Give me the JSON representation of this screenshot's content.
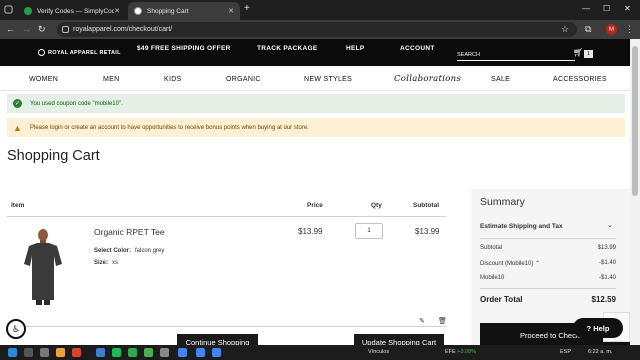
{
  "browser": {
    "tabs": [
      {
        "title": "Verify Codes — SimplyCodes",
        "favicon_color": "#21a04a"
      },
      {
        "title": "Shopping Cart",
        "favicon_color": "#ffffff"
      }
    ],
    "url": "royalapparel.com/checkout/cart/",
    "profile_initial": "M"
  },
  "site": {
    "logo": "ROYAL APPAREL RETAIL",
    "top_nav": [
      "$49 FREE SHIPPING OFFER",
      "TRACK PACKAGE",
      "HELP",
      "ACCOUNT"
    ],
    "search_placeholder": "SEARCH",
    "cart_count": "1",
    "categories": [
      "WOMEN",
      "MEN",
      "KIDS",
      "ORGANIC",
      "NEW STYLES",
      "Collaborations",
      "SALE",
      "ACCESSORIES"
    ]
  },
  "messages": {
    "success": "You used coupon code \"mobile10\".",
    "notice": "Please login or create an account to have opportunities to receive bonus points when buying at our store."
  },
  "page_title": "Shopping Cart",
  "cart": {
    "headers": {
      "item": "Item",
      "price": "Price",
      "qty": "Qty",
      "subtotal": "Subtotal"
    },
    "item": {
      "name": "Organic RPET Tee",
      "color_label": "Select Color:",
      "color_value": "falcon grey",
      "size_label": "Size:",
      "size_value": "xs",
      "price": "$13.99",
      "qty": "1",
      "subtotal": "$13.99"
    },
    "continue_label": "Continue Shopping",
    "update_label": "Update Shopping Cart"
  },
  "summary": {
    "title": "Summary",
    "estimate_label": "Estimate Shipping and Tax",
    "subtotal_label": "Subtotal",
    "subtotal_value": "$13.99",
    "discount_label": "Discount (Mobile10)",
    "discount_value": "-$1.40",
    "code_label": "Mobile10",
    "code_value": "-$1.40",
    "total_label": "Order Total",
    "total_value": "$12.59",
    "checkout_label": "Proceed to Checkout"
  },
  "help_label": "Help",
  "taskbar": {
    "weather_label": "Vínculos",
    "ticker": "EFE",
    "ticker_change": "+3.08%",
    "language": "ESP",
    "time": "6:22 a. m."
  }
}
